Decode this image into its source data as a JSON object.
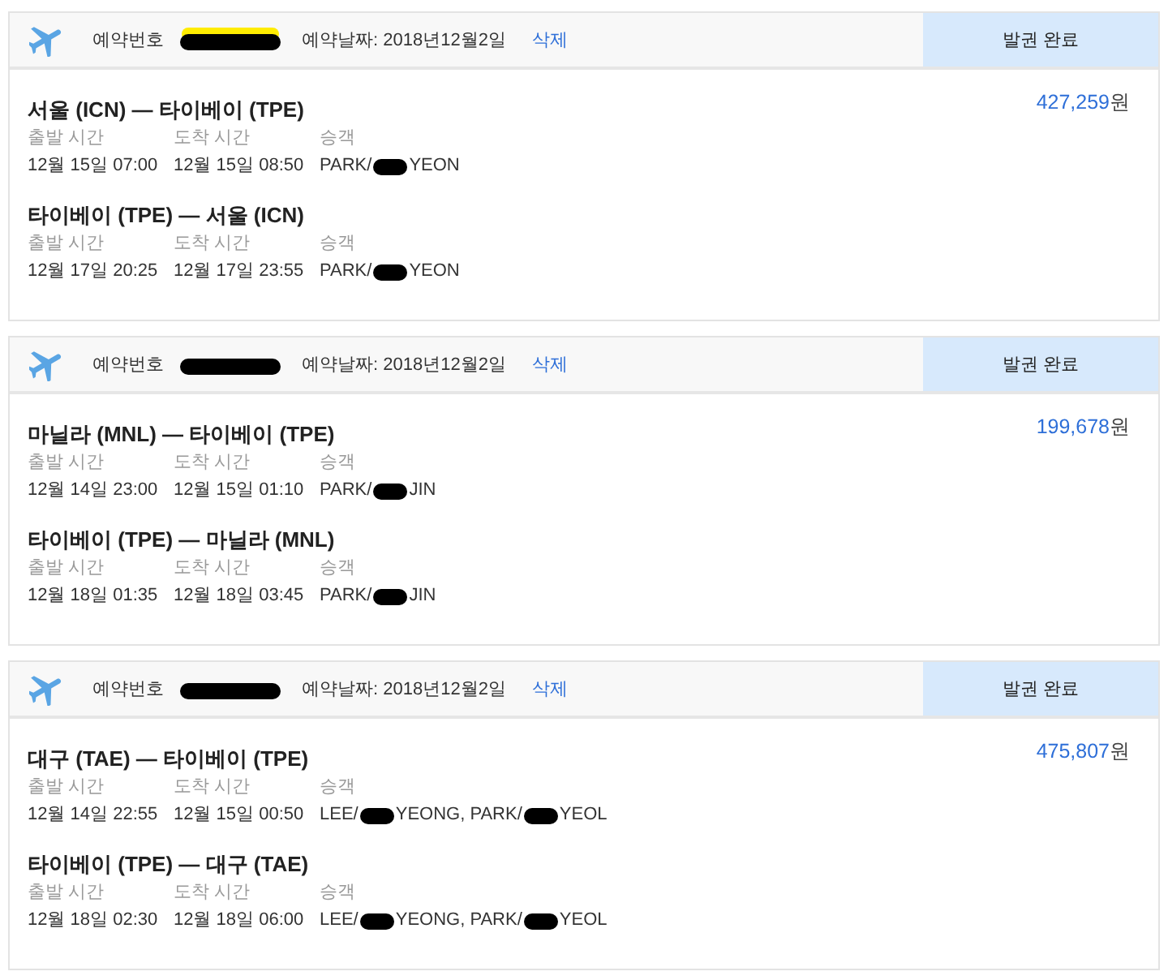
{
  "bookings": [
    {
      "booking_no_label": "예약번호",
      "booking_no": [
        {
          "kind": "redacted",
          "highlighted": true
        }
      ],
      "booking_date": "예약날짜: 2018년12월2일",
      "delete_link": "삭제",
      "status": "발권 완료",
      "price": "427,259",
      "currency": "원",
      "legs": [
        {
          "route": "서울 (ICN) — 타이베이 (TPE)",
          "departure_label": "출발 시간",
          "departure": "12월 15일 07:00",
          "arrival_label": "도착 시간",
          "arrival": "12월 15일 08:50",
          "passenger_label": "승객",
          "passenger": [
            {
              "kind": "text",
              "text": "PARK/"
            },
            {
              "kind": "redacted",
              "highlighted": false
            },
            {
              "kind": "text",
              "text": "YEON"
            }
          ]
        },
        {
          "route": "타이베이 (TPE) — 서울 (ICN)",
          "departure_label": "출발 시간",
          "departure": "12월 17일 20:25",
          "arrival_label": "도착 시간",
          "arrival": "12월 17일 23:55",
          "passenger_label": "승객",
          "passenger": [
            {
              "kind": "text",
              "text": "PARK/"
            },
            {
              "kind": "redacted",
              "highlighted": false
            },
            {
              "kind": "text",
              "text": "YEON"
            }
          ]
        }
      ]
    },
    {
      "booking_no_label": "예약번호",
      "booking_no": [
        {
          "kind": "redacted",
          "highlighted": false
        }
      ],
      "booking_date": "예약날짜: 2018년12월2일",
      "delete_link": "삭제",
      "status": "발권 완료",
      "price": "199,678",
      "currency": "원",
      "legs": [
        {
          "route": "마닐라 (MNL) — 타이베이 (TPE)",
          "departure_label": "출발 시간",
          "departure": "12월 14일 23:00",
          "arrival_label": "도착 시간",
          "arrival": "12월 15일 01:10",
          "passenger_label": "승객",
          "passenger": [
            {
              "kind": "text",
              "text": "PARK/"
            },
            {
              "kind": "redacted",
              "highlighted": false
            },
            {
              "kind": "text",
              "text": "JIN"
            }
          ]
        },
        {
          "route": "타이베이 (TPE) — 마닐라 (MNL)",
          "departure_label": "출발 시간",
          "departure": "12월 18일 01:35",
          "arrival_label": "도착 시간",
          "arrival": "12월 18일 03:45",
          "passenger_label": "승객",
          "passenger": [
            {
              "kind": "text",
              "text": "PARK/"
            },
            {
              "kind": "redacted",
              "highlighted": false
            },
            {
              "kind": "text",
              "text": "JIN"
            }
          ]
        }
      ]
    },
    {
      "booking_no_label": "예약번호",
      "booking_no": [
        {
          "kind": "redacted",
          "highlighted": false
        }
      ],
      "booking_date": "예약날짜: 2018년12월2일",
      "delete_link": "삭제",
      "status": "발권 완료",
      "price": "475,807",
      "currency": "원",
      "legs": [
        {
          "route": "대구 (TAE) — 타이베이 (TPE)",
          "departure_label": "출발 시간",
          "departure": "12월 14일 22:55",
          "arrival_label": "도착 시간",
          "arrival": "12월 15일 00:50",
          "passenger_label": "승객",
          "passenger": [
            {
              "kind": "text",
              "text": "LEE/"
            },
            {
              "kind": "redacted",
              "highlighted": false
            },
            {
              "kind": "text",
              "text": "YEONG, PARK/"
            },
            {
              "kind": "redacted",
              "highlighted": false
            },
            {
              "kind": "text",
              "text": "YEOL"
            }
          ]
        },
        {
          "route": "타이베이 (TPE) — 대구 (TAE)",
          "departure_label": "출발 시간",
          "departure": "12월 18일 02:30",
          "arrival_label": "도착 시간",
          "arrival": "12월 18일 06:00",
          "passenger_label": "승객",
          "passenger": [
            {
              "kind": "text",
              "text": "LEE/"
            },
            {
              "kind": "redacted",
              "highlighted": false
            },
            {
              "kind": "text",
              "text": "YEONG, PARK/"
            },
            {
              "kind": "redacted",
              "highlighted": false
            },
            {
              "kind": "text",
              "text": "YEOL"
            }
          ]
        }
      ]
    }
  ]
}
